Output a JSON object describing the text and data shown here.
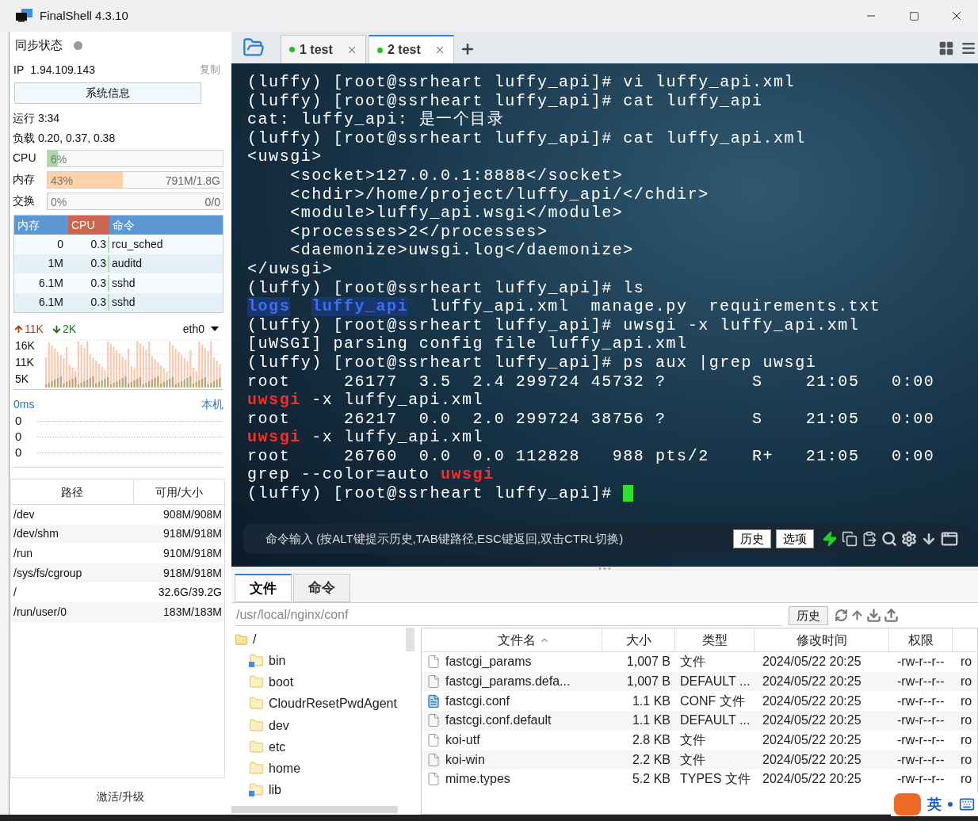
{
  "window": {
    "title": "FinalShell 4.3.10"
  },
  "sidebar": {
    "sync": {
      "label": "同步状态",
      "online": false
    },
    "ip": {
      "label": "IP",
      "value": "1.94.109.143",
      "copy": "复制"
    },
    "sysinfo_button": "系统信息",
    "uptime": "运行 3:34",
    "load": "负载 0.20, 0.37, 0.38",
    "meters": [
      {
        "label": "CPU",
        "kind": "cpu",
        "level": 0.06,
        "percent": "6%"
      },
      {
        "label": "内存",
        "kind": "memory",
        "level": 0.43,
        "percent": "43%",
        "reading": "791M/1.8G"
      },
      {
        "label": "交换",
        "kind": "swap",
        "level": 0,
        "percent": "0%",
        "reading": "0/0"
      }
    ],
    "processes": {
      "columns": [
        {
          "label": "内存",
          "selected": false
        },
        {
          "label": "CPU",
          "selected": true
        },
        {
          "label": "命令",
          "selected": false
        }
      ],
      "rows": [
        [
          "0",
          "0.3",
          "rcu_sched"
        ],
        [
          "1M",
          "0.3",
          "auditd"
        ],
        [
          "6.1M",
          "0.3",
          "sshd"
        ],
        [
          "6.1M",
          "0.3",
          "sshd"
        ]
      ]
    },
    "network": {
      "upload": "11K",
      "download": "2K",
      "interface": "eth0",
      "yticks": [
        "16K",
        "11K",
        "5K"
      ]
    },
    "ping": {
      "latency": "0ms",
      "host": "本机",
      "values": [
        "0",
        "0",
        "0"
      ]
    },
    "disks": {
      "columns": [
        "路径",
        "可用/大小"
      ],
      "rows": [
        {
          "path": "/dev",
          "usage": "908M/908M"
        },
        {
          "path": "/dev/shm",
          "usage": "918M/918M"
        },
        {
          "path": "/run",
          "usage": "910M/918M"
        },
        {
          "path": "/sys/fs/cgroup",
          "usage": "918M/918M"
        },
        {
          "path": "/",
          "usage": "32.6G/39.2G"
        },
        {
          "path": "/run/user/0",
          "usage": "183M/183M"
        }
      ]
    },
    "footer": "激活/升级"
  },
  "tabs": [
    {
      "number": "1",
      "label": "test",
      "selected": false
    },
    {
      "number": "2",
      "label": "test",
      "selected": true
    }
  ],
  "terminal": {
    "cursor": true,
    "lines": [
      [
        {
          "text": "(luffy) [root@ssrheart luffy_api]# vi luffy_api.xml",
          "kind": "output"
        }
      ],
      [
        {
          "text": "(luffy) [root@ssrheart luffy_api]# cat luffy_api",
          "kind": "output"
        }
      ],
      [
        {
          "text": "cat: luffy_api: 是一个目录",
          "kind": "output"
        }
      ],
      [
        {
          "text": "(luffy) [root@ssrheart luffy_api]# cat luffy_api.xml",
          "kind": "output"
        }
      ],
      [
        {
          "text": "<uwsgi>",
          "kind": "output"
        }
      ],
      [
        {
          "text": "    <socket>127.0.0.1:8888</socket>",
          "kind": "output"
        }
      ],
      [
        {
          "text": "    <chdir>/home/project/luffy_api/</chdir>",
          "kind": "output"
        }
      ],
      [
        {
          "text": "    <module>luffy_api.wsgi</module>",
          "kind": "output"
        }
      ],
      [
        {
          "text": "    <processes>2</processes>",
          "kind": "output"
        }
      ],
      [
        {
          "text": "    <daemonize>uwsgi.log</daemonize>",
          "kind": "output"
        }
      ],
      [
        {
          "text": "</uwsgi>",
          "kind": "output"
        }
      ],
      [
        {
          "text": "(luffy) [root@ssrheart luffy_api]# ls",
          "kind": "output"
        }
      ],
      [
        {
          "text": "logs",
          "kind": "directory"
        },
        {
          "text": "luffy_api",
          "kind": "directory"
        },
        {
          "text": "luffy_api.xml  manage.py  requirements.txt",
          "kind": "output"
        }
      ],
      [
        {
          "text": "(luffy) [root@ssrheart luffy_api]# uwsgi -x luffy_api.xml",
          "kind": "output"
        }
      ],
      [
        {
          "text": "[uWSGI] parsing config file luffy_api.xml",
          "kind": "output"
        }
      ],
      [
        {
          "text": "(luffy) [root@ssrheart luffy_api]# ps aux |grep uwsgi",
          "kind": "output"
        }
      ],
      [
        {
          "text": "root     26177  3.5  2.4 299724 45732 ?        S    21:05   0:00",
          "kind": "output"
        }
      ],
      [
        {
          "text": "uwsgi",
          "kind": "match"
        },
        {
          "text": " -x luffy_api.xml",
          "kind": "output"
        }
      ],
      [
        {
          "text": "root     26217  0.0  2.0 299724 38756 ?        S    21:05   0:00",
          "kind": "output"
        }
      ],
      [
        {
          "text": "uwsgi",
          "kind": "match"
        },
        {
          "text": " -x luffy_api.xml",
          "kind": "output"
        }
      ],
      [
        {
          "text": "root     26760  0.0  0.0 112828   988 pts/2    R+   21:05   0:00",
          "kind": "output"
        }
      ],
      [
        {
          "text": "grep --color=auto ",
          "kind": "output"
        },
        {
          "text": "uwsgi",
          "kind": "match"
        }
      ],
      [
        {
          "text": "(luffy) [root@ssrheart luffy_api]# ",
          "kind": "output"
        }
      ]
    ],
    "command_input": {
      "placeholder": "命令输入 (按ALT键提示历史,TAB键路径,ESC键返回,双击CTRL切换)",
      "buttons": [
        "历史",
        "选项"
      ]
    }
  },
  "file_panel": {
    "tabs": [
      {
        "label": "文件",
        "selected": true
      },
      {
        "label": "命令",
        "selected": false
      }
    ],
    "path": "/usr/local/nginx/conf",
    "history_button": "历史",
    "tree": {
      "label": "/",
      "children": [
        {
          "label": "bin",
          "kind": "link"
        },
        {
          "label": "boot",
          "kind": "folder"
        },
        {
          "label": "CloudrResetPwdAgent",
          "kind": "folder"
        },
        {
          "label": "dev",
          "kind": "folder"
        },
        {
          "label": "etc",
          "kind": "folder"
        },
        {
          "label": "home",
          "kind": "folder"
        },
        {
          "label": "lib",
          "kind": "link"
        }
      ]
    },
    "table": {
      "columns": [
        {
          "label": "文件名",
          "sorted": true
        },
        {
          "label": "大小",
          "sorted": false
        },
        {
          "label": "类型",
          "sorted": false
        },
        {
          "label": "修改时间",
          "sorted": false
        },
        {
          "label": "权限",
          "sorted": false
        }
      ],
      "rows": [
        {
          "kind": "file",
          "name": "fastcgi_params",
          "size": "1,007 B",
          "type": "文件",
          "modified": "2024/05/22 20:25",
          "permissions": "-rw-r--r--",
          "owner": "ro"
        },
        {
          "kind": "file",
          "name": "fastcgi_params.defa...",
          "size": "1,007 B",
          "type": "DEFAULT ...",
          "modified": "2024/05/22 20:25",
          "permissions": "-rw-r--r--",
          "owner": "ro"
        },
        {
          "kind": "conf",
          "name": "fastcgi.conf",
          "size": "1.1 KB",
          "type": "CONF 文件",
          "modified": "2024/05/22 20:25",
          "permissions": "-rw-r--r--",
          "owner": "ro"
        },
        {
          "kind": "file",
          "name": "fastcgi.conf.default",
          "size": "1.1 KB",
          "type": "DEFAULT ...",
          "modified": "2024/05/22 20:25",
          "permissions": "-rw-r--r--",
          "owner": "ro"
        },
        {
          "kind": "file",
          "name": "koi-utf",
          "size": "2.8 KB",
          "type": "文件",
          "modified": "2024/05/22 20:25",
          "permissions": "-rw-r--r--",
          "owner": "ro"
        },
        {
          "kind": "file",
          "name": "koi-win",
          "size": "2.2 KB",
          "type": "文件",
          "modified": "2024/05/22 20:25",
          "permissions": "-rw-r--r--",
          "owner": "ro"
        },
        {
          "kind": "file",
          "name": "mime.types",
          "size": "5.2 KB",
          "type": "TYPES 文件",
          "modified": "2024/05/22 20:25",
          "permissions": "-rw-r--r--",
          "owner": "ro"
        }
      ]
    }
  },
  "ime": {
    "label": "英"
  }
}
